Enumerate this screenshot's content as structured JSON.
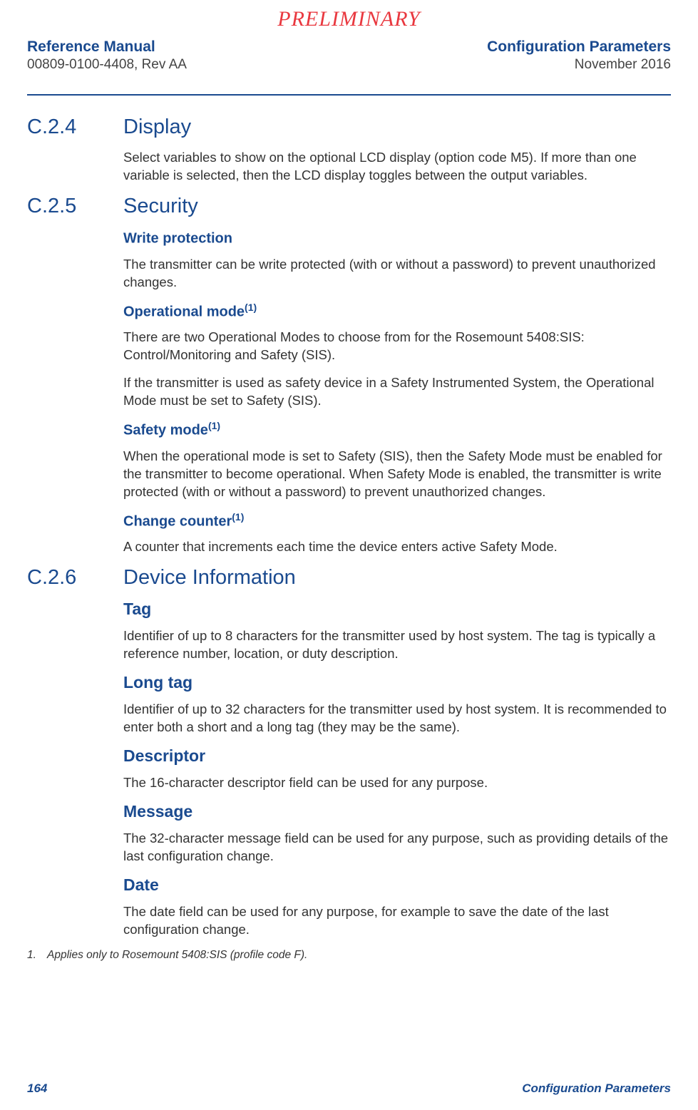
{
  "watermark": "PRELIMINARY",
  "header": {
    "left_title": "Reference Manual",
    "left_sub": "00809-0100-4408, Rev AA",
    "right_title": "Configuration Parameters",
    "right_sub": "November 2016"
  },
  "sections": [
    {
      "num": "C.2.4",
      "title": "Display",
      "intro": "Select variables to show on the optional LCD display (option code M5). If more than one variable is selected, then the LCD display toggles between the output variables."
    },
    {
      "num": "C.2.5",
      "title": "Security",
      "subs": [
        {
          "head": "Write protection",
          "foot": "",
          "paras": [
            "The transmitter can be write protected (with or without a password) to prevent unauthorized changes."
          ]
        },
        {
          "head": "Operational mode",
          "foot": "(1)",
          "paras": [
            "There are two Operational Modes to choose from for the Rosemount 5408:SIS: Control/Monitoring and Safety (SIS).",
            "If the transmitter is used as safety device in a Safety Instrumented System, the Operational Mode must be set to Safety (SIS)."
          ]
        },
        {
          "head": "Safety mode",
          "foot": "(1)",
          "paras": [
            "When the operational mode is set to Safety (SIS), then the Safety Mode must be enabled for the transmitter to become operational. When Safety Mode is enabled, the transmitter is write protected (with or without a password) to prevent unauthorized changes."
          ]
        },
        {
          "head": "Change counter",
          "foot": "(1)",
          "paras": [
            "A counter that increments each time the device enters active Safety Mode."
          ]
        }
      ]
    },
    {
      "num": "C.2.6",
      "title": "Device Information",
      "large": true,
      "subs": [
        {
          "head": "Tag",
          "foot": "",
          "paras": [
            "Identifier of up to 8 characters for the transmitter used by host system. The tag is typically a reference number, location, or duty description."
          ]
        },
        {
          "head": "Long tag",
          "foot": "",
          "paras": [
            "Identifier of up to 32 characters for the transmitter used by host system. It is recommended to enter both a short and a long tag (they may be the same)."
          ]
        },
        {
          "head": "Descriptor",
          "foot": "",
          "paras": [
            "The 16-character descriptor field can be used for any purpose."
          ]
        },
        {
          "head": "Message",
          "foot": "",
          "paras": [
            "The 32-character message field can be used for any purpose, such as providing details of the last configuration change."
          ]
        },
        {
          "head": "Date",
          "foot": "",
          "paras": [
            "The date field can be used for any purpose, for example to save the date of the last configuration change."
          ]
        }
      ]
    }
  ],
  "footnote": {
    "num": "1.",
    "text": "Applies only to Rosemount 5408:SIS (profile code F)."
  },
  "footer": {
    "page": "164",
    "title": "Configuration Parameters"
  }
}
